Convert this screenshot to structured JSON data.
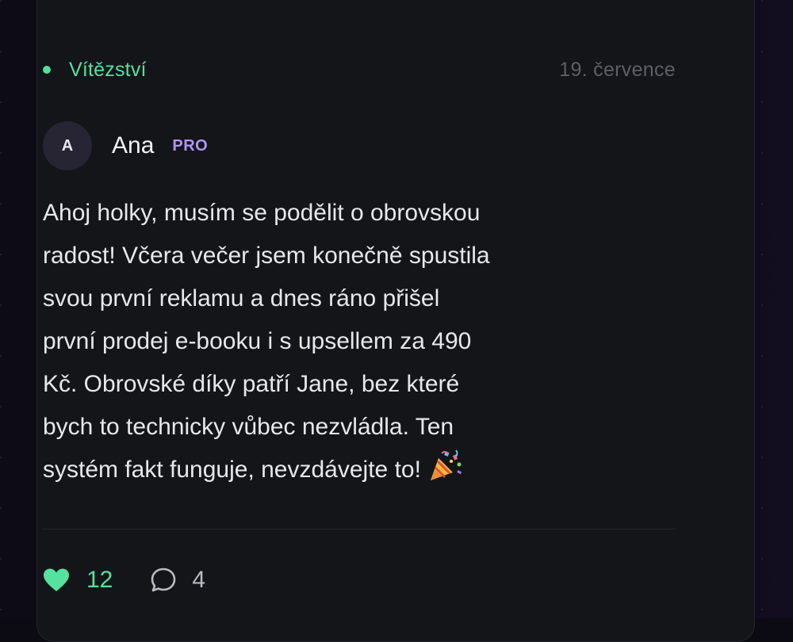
{
  "post": {
    "category": "Vítězství",
    "date": "19. července",
    "author": {
      "initial": "A",
      "name": "Ana",
      "badge": "PRO"
    },
    "body": "Ahoj holky, musím se podělit o obrovskou\nradost! Včera večer jsem konečně spustila\nsvou první reklamu a dnes ráno přišel\nprvní prodej e-booku i s upsellem za 490\nKč. Obrovské díky patří Jane, bez které\nbych to technicky vůbec nezvládla. Ten\nsystém fakt funguje, nevzdávejte to!",
    "body_emoji_icon": "party-popper-icon",
    "likes": "12",
    "comments": "4"
  },
  "colors": {
    "accent": "#55e29f",
    "pro_badge": "#b294f5",
    "card": "#131518",
    "date": "#5b5f66"
  },
  "icons": {
    "category_marker": "green-dot-icon",
    "like": "heart-icon",
    "comment": "speech-bubble-icon"
  }
}
